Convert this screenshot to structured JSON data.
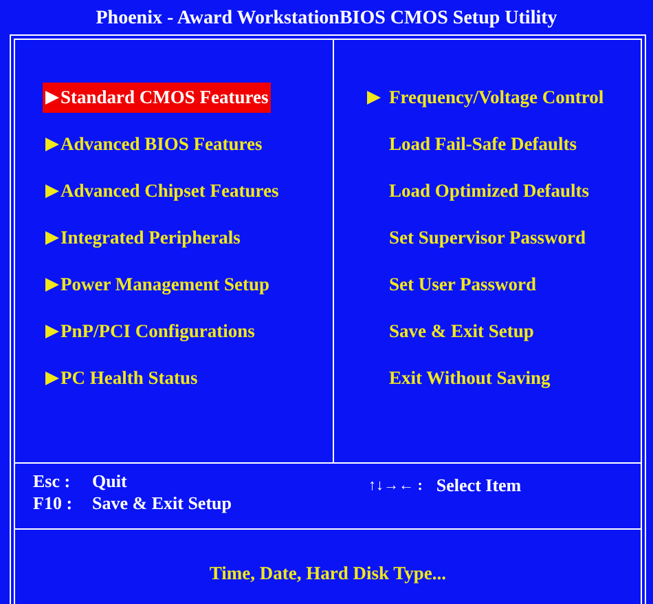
{
  "title": "Phoenix - Award WorkstationBIOS CMOS Setup Utility",
  "menu_left": [
    {
      "label": "Standard CMOS Features",
      "submenu": true,
      "selected": true
    },
    {
      "label": "Advanced BIOS Features",
      "submenu": true,
      "selected": false
    },
    {
      "label": "Advanced Chipset Features",
      "submenu": true,
      "selected": false
    },
    {
      "label": "Integrated Peripherals",
      "submenu": true,
      "selected": false
    },
    {
      "label": "Power Management Setup",
      "submenu": true,
      "selected": false
    },
    {
      "label": "PnP/PCI Configurations",
      "submenu": true,
      "selected": false
    },
    {
      "label": "PC Health Status",
      "submenu": true,
      "selected": false
    }
  ],
  "menu_right": [
    {
      "label": "Frequency/Voltage Control",
      "submenu": true,
      "selected": false
    },
    {
      "label": "Load Fail-Safe Defaults",
      "submenu": false,
      "selected": false
    },
    {
      "label": "Load Optimized Defaults",
      "submenu": false,
      "selected": false
    },
    {
      "label": "Set Supervisor Password",
      "submenu": false,
      "selected": false
    },
    {
      "label": "Set User Password",
      "submenu": false,
      "selected": false
    },
    {
      "label": "Save & Exit Setup",
      "submenu": false,
      "selected": false
    },
    {
      "label": "Exit Without Saving",
      "submenu": false,
      "selected": false
    }
  ],
  "key_help_left": [
    {
      "key": "Esc :",
      "action": "Quit"
    },
    {
      "key": "F10 :",
      "action": "Save & Exit Setup"
    }
  ],
  "key_help_right": [
    {
      "key": "↑↓→← :",
      "action": "Select Item"
    }
  ],
  "description": "Time, Date, Hard Disk Type..."
}
